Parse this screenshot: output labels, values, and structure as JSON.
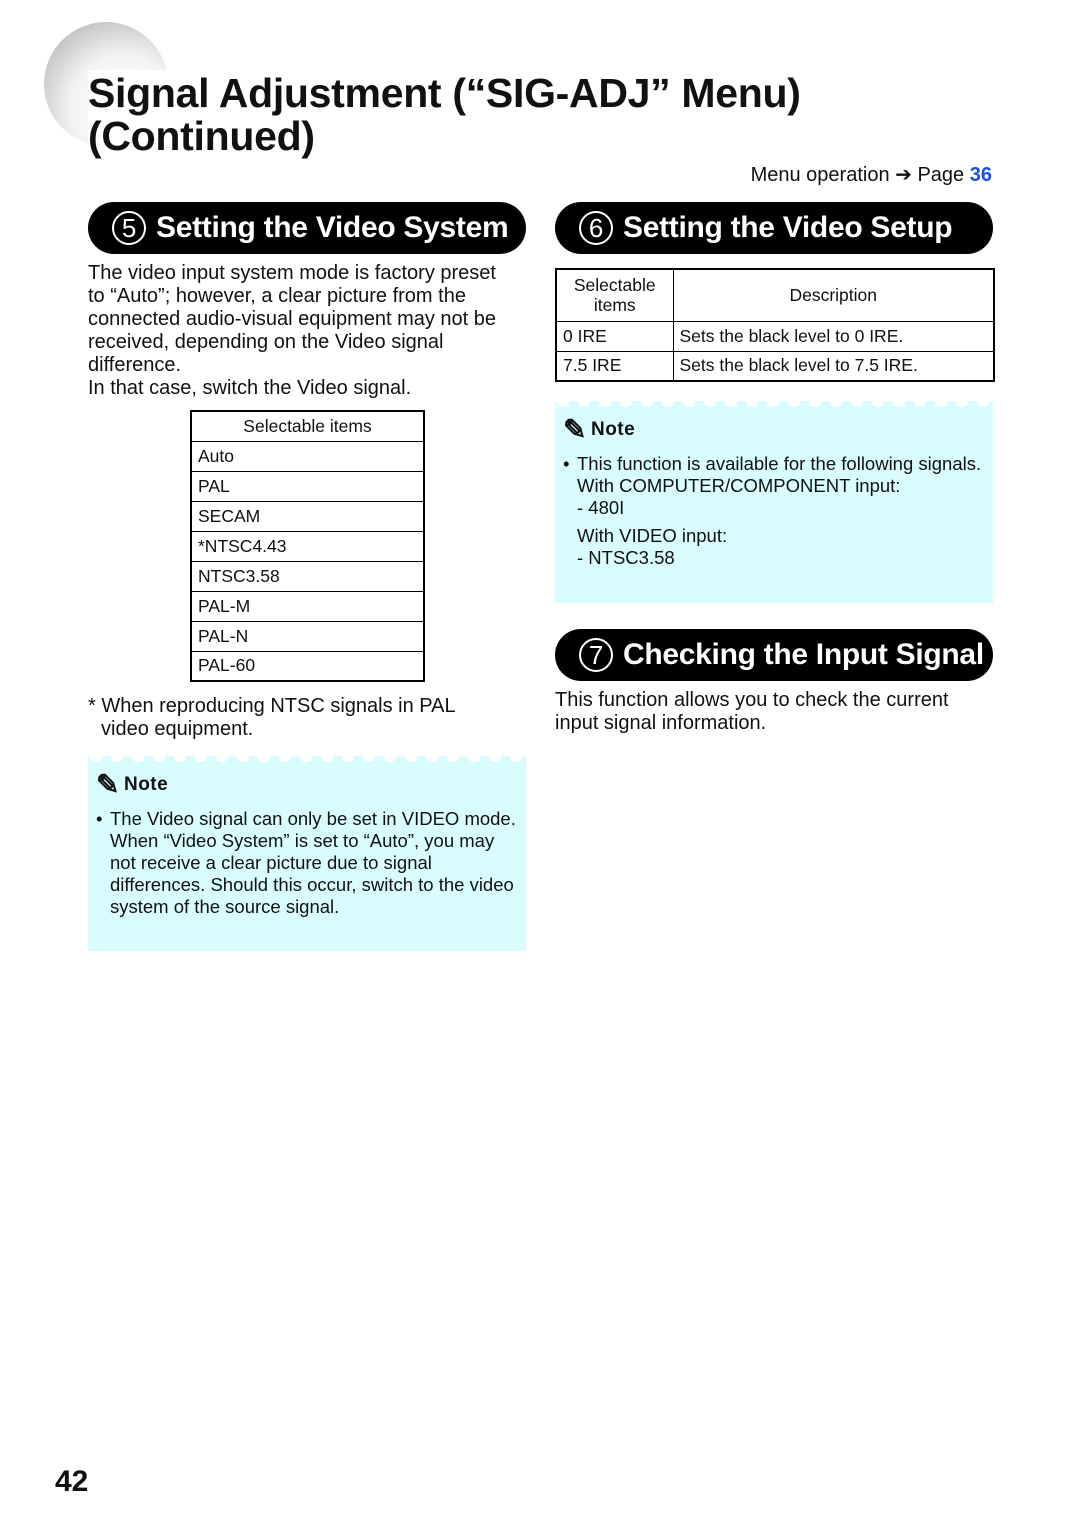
{
  "header": {
    "title_line1": "Signal Adjustment (“SIG-ADJ” Menu)",
    "title_line2": "(Continued)",
    "menu_op": "Menu operation",
    "arrow": "➔",
    "page_label": "Page",
    "page_ref": "36"
  },
  "s5": {
    "num": "5",
    "title": "Setting the Video System",
    "para": [
      "The video input system mode is factory preset",
      "to “Auto”; however, a clear picture from the",
      "connected audio-visual equipment may not be",
      "received, depending on the Video signal",
      "difference.",
      "In that case, switch the Video signal."
    ],
    "table_header": "Selectable items",
    "items": [
      "Auto",
      "PAL",
      "SECAM",
      "*NTSC4.43",
      "NTSC3.58",
      "PAL-M",
      "PAL-N",
      "PAL-60"
    ],
    "footnote_line1": "* When reproducing NTSC signals in PAL",
    "footnote_line2": "video equipment.",
    "note": {
      "label": "Note",
      "bullets": [
        "The Video signal can only be set in VIDEO mode.",
        "When “Video System” is set to “Auto”, you may not receive a clear picture due to signal differences. Should this occur, switch to the video system of the source signal."
      ]
    }
  },
  "s6": {
    "num": "6",
    "title": "Setting the Video Setup",
    "table": {
      "headers": [
        "Selectable items",
        "Description"
      ],
      "rows": [
        [
          "0 IRE",
          "Sets the black level to 0 IRE."
        ],
        [
          "7.5 IRE",
          "Sets the black level to 7.5 IRE."
        ]
      ]
    },
    "note": {
      "label": "Note",
      "bullet": "This function is available for the following signals.",
      "line1": "With COMPUTER/COMPONENT input:",
      "line2": "- 480I",
      "line3": "With VIDEO input:",
      "line4": "- NTSC3.58"
    }
  },
  "s7": {
    "num": "7",
    "title": "Checking the Input Signal",
    "para": "This function allows you to check the current input signal information."
  },
  "page_number": "42",
  "colors": {
    "note_bg": "#d9fdfe",
    "link": "#1a4fd8"
  }
}
